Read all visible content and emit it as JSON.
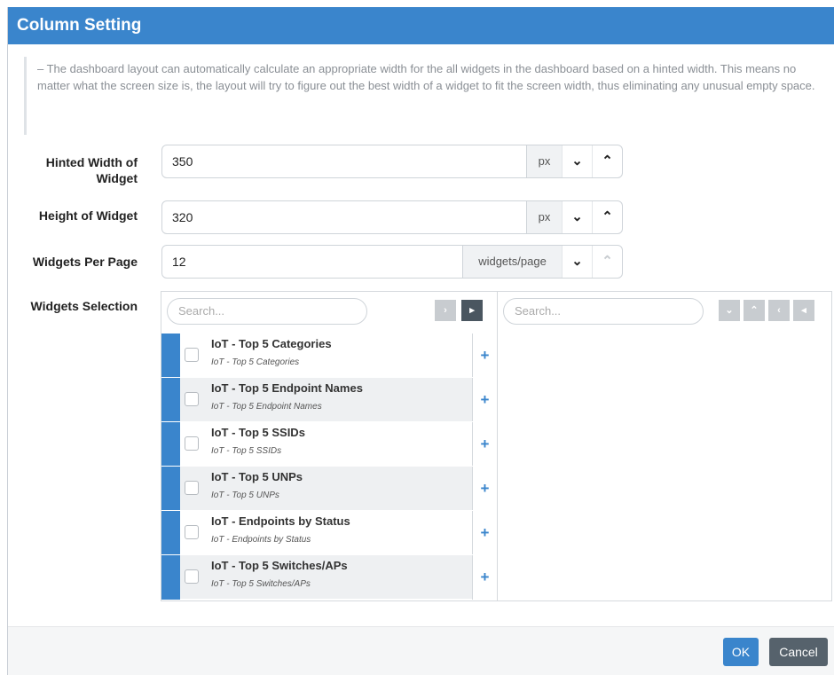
{
  "dialog": {
    "title": "Column Setting"
  },
  "info": {
    "text": "– The dashboard layout can automatically calculate an appropriate width for the all widgets in the dashboard based on a hinted width. This means no matter what the screen size is, the layout will try to figure out the best width of a widget to fit the screen width, thus eliminating any unusual empty space."
  },
  "fields": {
    "hinted_width": {
      "label": "Hinted Width of Widget",
      "value": "350",
      "unit": "px"
    },
    "height": {
      "label": "Height of Widget",
      "value": "320",
      "unit": "px"
    },
    "per_page": {
      "label": "Widgets Per Page",
      "value": "12",
      "unit": "widgets/page"
    }
  },
  "selection": {
    "label": "Widgets Selection",
    "left_search_placeholder": "Search...",
    "right_search_placeholder": "Search...",
    "items": [
      {
        "title": "IoT - Top 5 Categories",
        "subtitle": "IoT - Top 5 Categories"
      },
      {
        "title": "IoT - Top 5 Endpoint Names",
        "subtitle": "IoT - Top 5 Endpoint Names"
      },
      {
        "title": "IoT - Top 5 SSIDs",
        "subtitle": "IoT - Top 5 SSIDs"
      },
      {
        "title": "IoT - Top 5 UNPs",
        "subtitle": "IoT - Top 5 UNPs"
      },
      {
        "title": "IoT - Endpoints by Status",
        "subtitle": "IoT - Endpoints by Status"
      },
      {
        "title": "IoT - Top 5 Switches/APs",
        "subtitle": "IoT - Top 5 Switches/APs"
      }
    ]
  },
  "footer": {
    "ok_label": "OK",
    "cancel_label": "Cancel"
  },
  "icons": {
    "spin_down": "chevron-down-icon",
    "spin_up": "chevron-up-icon",
    "add": "plus-icon"
  },
  "colors": {
    "accent": "#3a85cc",
    "cancel": "#56626c"
  }
}
